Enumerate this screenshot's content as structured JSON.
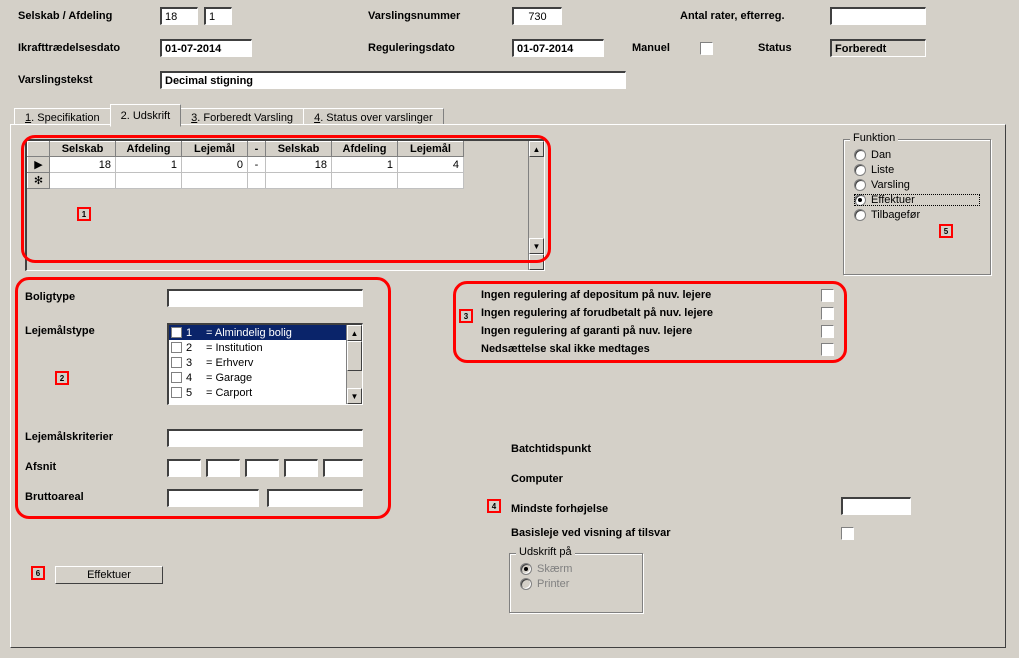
{
  "header": {
    "selskab_afdeling_label": "Selskab / Afdeling",
    "selskab": "18",
    "afdeling": "1",
    "varslingsnummer_label": "Varslingsnummer",
    "varslingsnummer": "730",
    "antal_rater_label": "Antal rater, efterreg.",
    "antal_rater": "",
    "ikraft_label": "Ikrafttrædelsesdato",
    "ikraft": "01-07-2014",
    "reguleringsdato_label": "Reguleringsdato",
    "reguleringsdato": "01-07-2014",
    "manuel_label": "Manuel",
    "status_label": "Status",
    "status": "Forberedt",
    "varslingstekst_label": "Varslingstekst",
    "varslingstekst": "Decimal stigning"
  },
  "tabs": {
    "t1": "1. Specifikation",
    "t2": "2. Udskrift",
    "t3": "3. Forberedt Varsling",
    "t4": "4. Status over varslinger"
  },
  "grid": {
    "headers": [
      "Selskab",
      "Afdeling",
      "Lejemål",
      "-",
      "Selskab",
      "Afdeling",
      "Lejemål"
    ],
    "row": [
      "18",
      "1",
      "0",
      "-",
      "18",
      "1",
      "4"
    ]
  },
  "funktion": {
    "title": "Funktion",
    "dan": "Dan",
    "liste": "Liste",
    "varsling": "Varsling",
    "effektuer": "Effektuer",
    "tilbagefor": "Tilbagefør"
  },
  "left": {
    "boligtype_label": "Boligtype",
    "lejemalstype_label": "Lejemålstype",
    "lejemalskriterier_label": "Lejemålskriterier",
    "afsnit_label": "Afsnit",
    "bruttoareal_label": "Bruttoareal",
    "types": [
      {
        "n": "1",
        "t": "= Almindelig bolig"
      },
      {
        "n": "2",
        "t": "= Institution"
      },
      {
        "n": "3",
        "t": "= Erhverv"
      },
      {
        "n": "4",
        "t": "= Garage"
      },
      {
        "n": "5",
        "t": "= Carport"
      }
    ]
  },
  "right_checks": {
    "c1": "Ingen regulering af depositum på nuv. lejere",
    "c2": "Ingen regulering af forudbetalt på nuv. lejere",
    "c3": "Ingen regulering af garanti på nuv. lejere",
    "c4": "Nedsættelse skal ikke medtages"
  },
  "lower_right": {
    "batch": "Batchtidspunkt",
    "computer": "Computer",
    "mindste": "Mindste forhøjelse",
    "basisleje": "Basisleje ved visning af tilsvar",
    "udskrift_title": "Udskrift på",
    "skaerm": "Skærm",
    "printer": "Printer"
  },
  "button": {
    "effektuer": "Effektuer"
  },
  "markers": {
    "m1": "1",
    "m2": "2",
    "m3": "3",
    "m4": "4",
    "m5": "5",
    "m6": "6"
  }
}
